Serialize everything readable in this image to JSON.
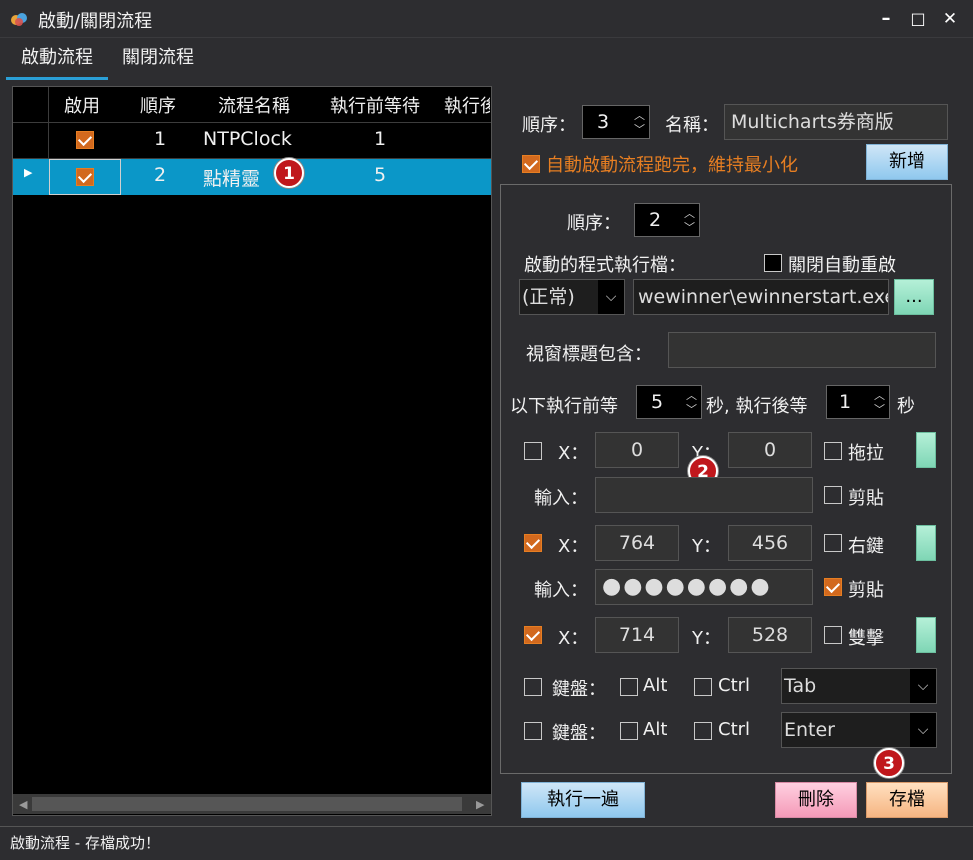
{
  "window": {
    "title": "啟動/關閉流程",
    "minimize": "–",
    "maximize": "□",
    "close": "✕"
  },
  "tabs": [
    {
      "label": "啟動流程"
    },
    {
      "label": "關閉流程"
    }
  ],
  "grid": {
    "headers": [
      "啟用",
      "順序",
      "流程名稱",
      "執行前等待",
      "執行後"
    ],
    "rows": [
      {
        "enabled": true,
        "order": "1",
        "name": "NTPClock",
        "wait_before": "1",
        "selected": false
      },
      {
        "enabled": true,
        "order": "2",
        "name": "點精靈",
        "wait_before": "5",
        "selected": true
      }
    ]
  },
  "form": {
    "order_label": "順序：",
    "order_value": "3",
    "name_label": "名稱：",
    "name_value": "Multicharts券商版",
    "auto_minimize_label": "自動啟動流程跑完，維持最小化",
    "add_button": "新增"
  },
  "step": {
    "order_label": "順序：",
    "order_value": "2",
    "exe_label": "啟動的程式執行檔：",
    "close_restart_label": "關閉自動重啟",
    "mode_value": "(正常)",
    "exe_path": "wewinner\\ewinnerstart.exe",
    "browse_button": "...",
    "title_label": "視窗標題包含：",
    "title_value": "",
    "wait_before_label": "以下執行前等",
    "wait_before_value": "5",
    "wait_after_label": "秒, 執行後等",
    "wait_after_value": "1",
    "seconds_label": "秒",
    "actions": [
      {
        "checked": false,
        "x": "0",
        "y": "0",
        "option": "拖拉",
        "option_checked": false,
        "input_label": "輸入：",
        "input_value": "",
        "input_option": "剪貼",
        "input_option_checked": false
      },
      {
        "checked": true,
        "x": "764",
        "y": "456",
        "option": "右鍵",
        "option_checked": false,
        "input_label": "輸入：",
        "input_value": "●●●●●●●●",
        "input_option": "剪貼",
        "input_option_checked": true
      },
      {
        "checked": true,
        "x": "714",
        "y": "528",
        "option": "雙擊",
        "option_checked": false
      }
    ],
    "x_label": "X：",
    "y_label": "Y：",
    "keyboard": [
      {
        "label": "鍵盤：",
        "alt": "Alt",
        "ctrl": "Ctrl",
        "key": "Tab"
      },
      {
        "label": "鍵盤：",
        "alt": "Alt",
        "ctrl": "Ctrl",
        "key": "Enter"
      }
    ]
  },
  "buttons": {
    "run_once": "執行一遍",
    "delete": "刪除",
    "save": "存檔"
  },
  "badges": [
    "1",
    "2",
    "3"
  ],
  "status": "啟動流程 - 存檔成功！"
}
